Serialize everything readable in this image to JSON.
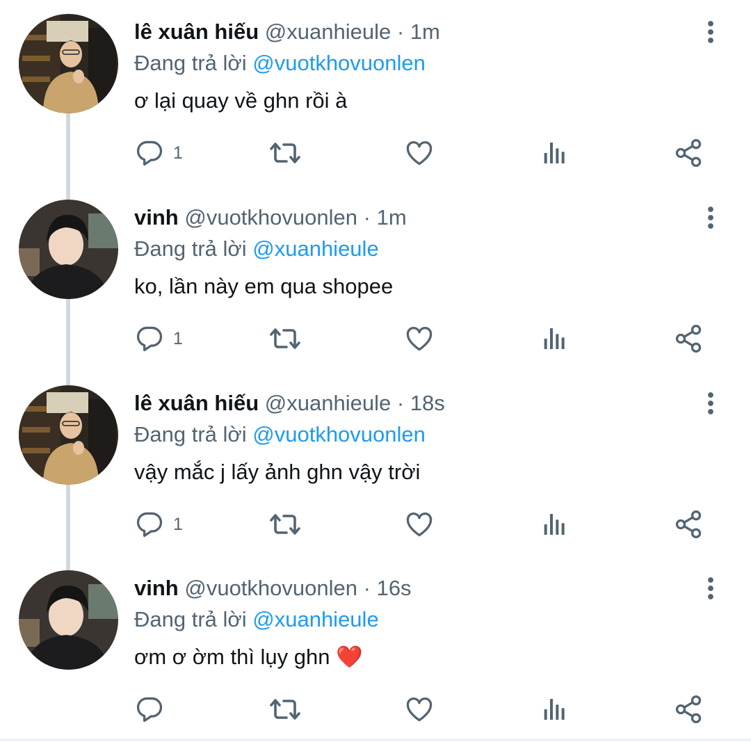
{
  "colors": {
    "text_primary": "#0f1419",
    "text_secondary": "#536471",
    "link": "#1d9bf0",
    "thread_line": "#cfd9de",
    "icon": "#536471",
    "heart_emoji": "#dd2e44"
  },
  "icons": [
    "reply-icon",
    "retweet-icon",
    "like-icon",
    "views-icon",
    "share-icon",
    "more-icon"
  ],
  "tweets": [
    {
      "name": "lê xuân hiếu",
      "handle": "@xuanhieule",
      "dot": "·",
      "time": "1m",
      "reply_prefix": "Đang trả lời",
      "reply_to": "@vuotkhovuonlen",
      "text": "ơ lại quay về ghn rồi à",
      "reply_count": "1"
    },
    {
      "name": "vinh",
      "handle": "@vuotkhovuonlen",
      "dot": "·",
      "time": "1m",
      "reply_prefix": "Đang trả lời",
      "reply_to": "@xuanhieule",
      "text": "ko, lần này em qua shopee",
      "reply_count": "1"
    },
    {
      "name": "lê xuân hiếu",
      "handle": "@xuanhieule",
      "dot": "·",
      "time": "18s",
      "reply_prefix": "Đang trả lời",
      "reply_to": "@vuotkhovuonlen",
      "text": "vậy mắc j lấy ảnh ghn vậy trời",
      "reply_count": "1"
    },
    {
      "name": "vinh",
      "handle": "@vuotkhovuonlen",
      "dot": "·",
      "time": "16s",
      "reply_prefix": "Đang trả lời",
      "reply_to": "@xuanhieule",
      "text": "ơm ơ ờm thì lụy ghn ",
      "emoji": "❤️",
      "reply_count": ""
    }
  ]
}
